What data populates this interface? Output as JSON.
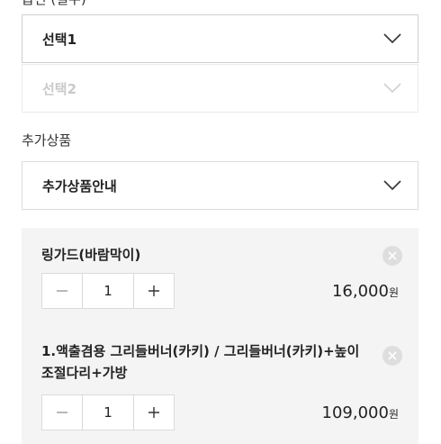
{
  "options": {
    "cut_label": "옵션 (필수)",
    "select1": "선택1",
    "select2": "선택2"
  },
  "addon": {
    "label": "추가상품",
    "select": "추가상품안내"
  },
  "cart": [
    {
      "name": "링가드(바람막이)",
      "qty": "1",
      "price": "16,000",
      "unit": "원"
    },
    {
      "name": "1.액출겸용 그리들버너(카키) / 그리들버너(카키)+높이조절다리+가방",
      "qty": "1",
      "price": "109,000",
      "unit": "원"
    }
  ],
  "icons": {
    "chevron": "chevron-down-icon",
    "remove": "close-icon",
    "minus": "minus-icon",
    "plus": "plus-icon"
  }
}
